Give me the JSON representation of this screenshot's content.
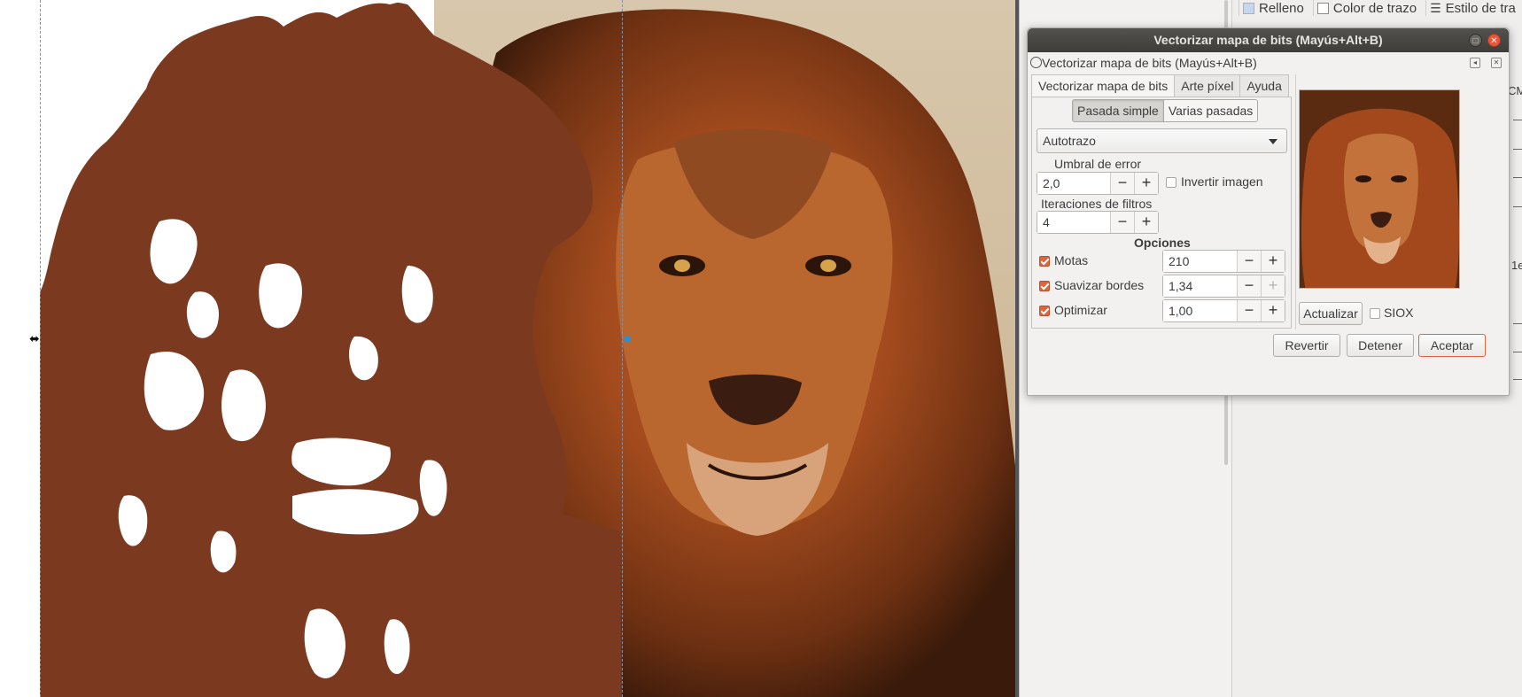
{
  "colors": {
    "trace_fill": "#7b3a20",
    "accent": "#e1643a",
    "titlebar": "#3e3d39"
  },
  "dock": {
    "fill_stroke_tabs": [
      "Relleno",
      "Color de trazo",
      "Estilo de tra"
    ],
    "edge_fragments": [
      "CM",
      "1e"
    ]
  },
  "dialog": {
    "window_title": "Vectorizar mapa de bits (Mayús+Alt+B)",
    "panel_title": "Vectorizar mapa de bits (Mayús+Alt+B)",
    "tabs": [
      "Vectorizar mapa de bits",
      "Arte píxel",
      "Ayuda"
    ],
    "modes": [
      "Pasada simple",
      "Varias pasadas"
    ],
    "method": "Autotrazo",
    "threshold": {
      "label": "Umbral de error",
      "value": "2,0"
    },
    "invert": {
      "label": "Invertir imagen",
      "checked": false
    },
    "filter_iterations": {
      "label": "Iteraciones de filtros",
      "value": "4"
    },
    "options_heading": "Opciones",
    "options": [
      {
        "label": "Motas",
        "checked": true,
        "value": "210"
      },
      {
        "label": "Suavizar bordes",
        "checked": true,
        "value": "1,34"
      },
      {
        "label": "Optimizar",
        "checked": true,
        "value": "1,00"
      }
    ],
    "update_button": "Actualizar",
    "siox": {
      "label": "SIOX",
      "checked": false
    },
    "buttons": {
      "revert": "Revertir",
      "stop": "Detener",
      "accept": "Aceptar"
    },
    "spin_minus": "−",
    "spin_plus": "+"
  }
}
